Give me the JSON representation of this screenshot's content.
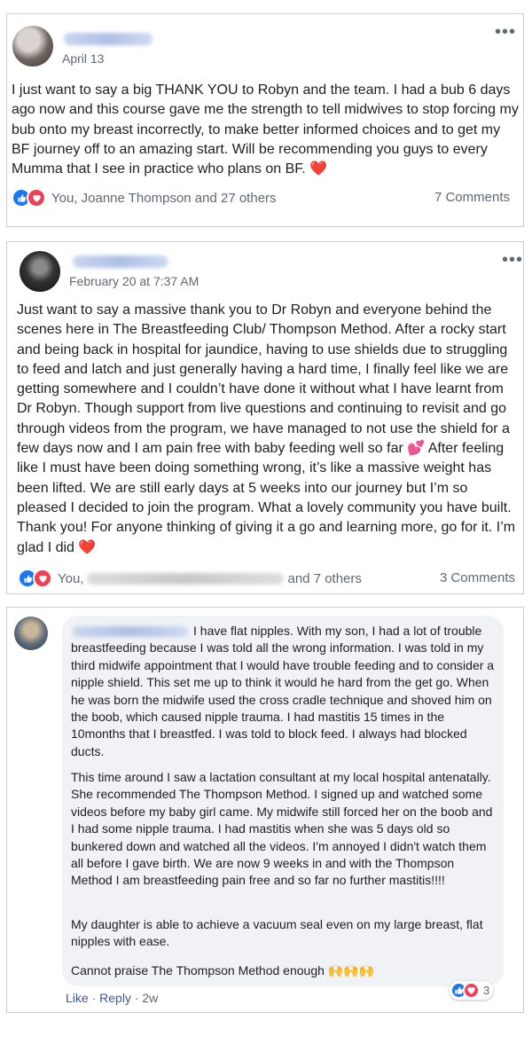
{
  "post1": {
    "date": "April 13",
    "text": "I just want to say a big THANK YOU to Robyn and the team. I had a bub 6 days ago now and this course gave me the strength to tell midwives to stop forcing my bub onto my breast incorrectly, to make better informed choices and to get my BF journey off to an amazing start. Will be recommending you guys to every Mumma that I see in practice who plans on BF.",
    "emoji_end": "❤️",
    "reactions": "You, Joanne Thompson and 27 others",
    "comments": "7 Comments"
  },
  "post2": {
    "date": "February 20 at 7:37 AM",
    "text_part1": "Just want to say a massive thank you to Dr Robyn and everyone behind the scenes here in The Breastfeeding Club/ Thompson Method. After a rocky start and being back in hospital for jaundice, having to use shields due to struggling to feed and latch and just generally having a hard time, I finally feel like we are getting somewhere and I couldn’t have done it without what I have learnt from Dr Robyn. Though support from live questions and continuing to revisit and go through videos from the program, we have managed to not use the shield for a few days now and I am pain free with baby feeding well so far",
    "emoji_mid": "💕",
    "text_part2": "After feeling like I must have been doing something wrong, it’s like a massive weight has been lifted. We are still early days at 5 weeks into our journey but I’m so pleased I decided to join the program. What a lovely community you have built. Thank you! For anyone thinking of giving it a go and learning more, go for it. I’m glad I did",
    "emoji_end": "❤️",
    "reactions_prefix": "You,",
    "reactions_suffix": "and 7 others",
    "comments": "3 Comments"
  },
  "comment": {
    "para1": "I have flat nipples. With my son, I had a lot of trouble breastfeeding because I was told all the wrong information. I was told in my third midwife appointment that I would have trouble feeding and to consider a nipple shield. This set me up to think it would he hard from the get go. When he was born the midwife used the cross cradle technique and shoved him on the boob, which caused nipple trauma. I had mastitis 15 times in the 10months that I breastfed. I was told to block feed. I always had blocked ducts.",
    "para2": "This time around I saw a lactation consultant at my local hospital antenatally. She recommended The Thompson Method. I signed up and watched some videos before my baby girl came. My midwife still forced her on the boob and I had some nipple trauma. I had mastitis when she was 5 days old so bunkered down and watched all the videos. I'm annoyed I didn't watch them all before I gave birth. We are now 9 weeks in and with the Thompson Method I am breastfeeding pain free and so far no further mastitis!!!!",
    "para3": "My daughter is able to achieve a vacuum seal even on my large breast, flat nipples with ease.",
    "para4": "Cannot praise The Thompson Method enough",
    "emoji_end": "🙌🙌🙌",
    "like": "Like",
    "reply": "Reply",
    "time": "2w",
    "reaction_count": "3"
  },
  "colors": {
    "like_blue": "#1877f2",
    "love_red": "#f33e58",
    "link_blue": "#385898"
  }
}
